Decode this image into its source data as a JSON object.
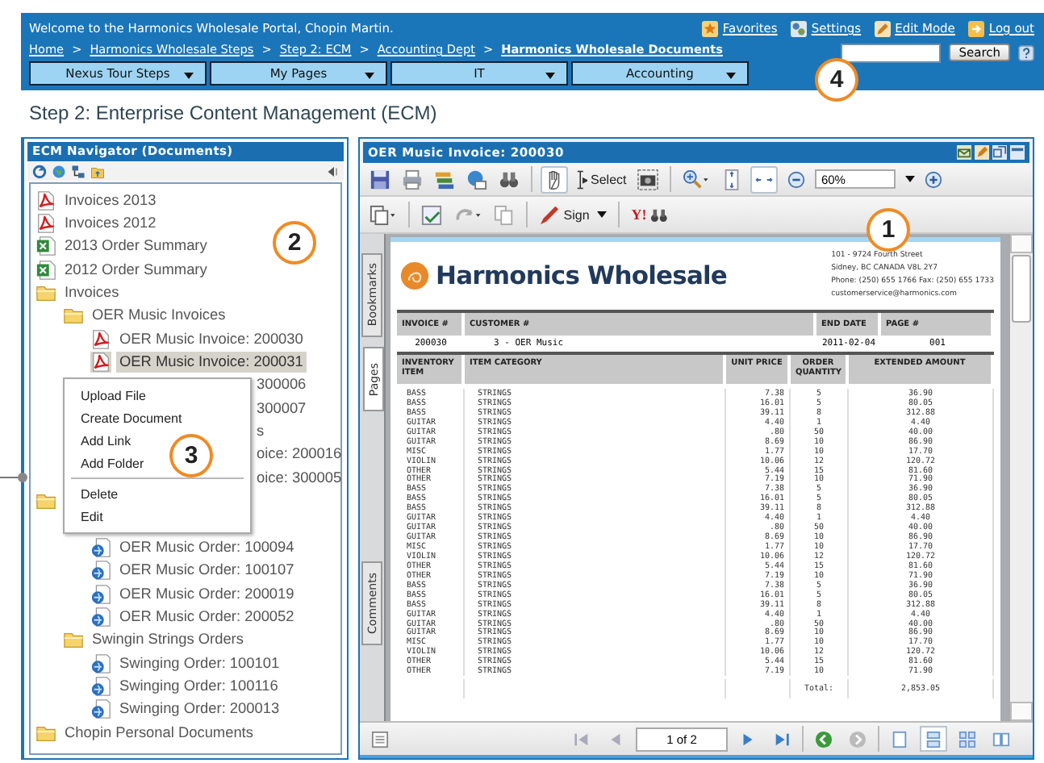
{
  "header": {
    "welcome": "Welcome to the Harmonics Wholesale Portal, Chopin Martin.",
    "links": [
      {
        "kind": "favorites",
        "label": "Favorites"
      },
      {
        "kind": "settings",
        "label": "Settings"
      },
      {
        "kind": "edit",
        "label": "Edit Mode"
      },
      {
        "kind": "logout",
        "label": "Log out"
      }
    ],
    "breadcrumbs": [
      {
        "label": "Home",
        "current": false
      },
      {
        "label": "Harmonics Wholesale Steps",
        "current": false
      },
      {
        "label": "Step 2: ECM",
        "current": false
      },
      {
        "label": "Accounting Dept",
        "current": false
      },
      {
        "label": "Harmonics Wholesale Documents",
        "current": true
      }
    ],
    "breadcrumb_separator": ">",
    "search_button": "Search",
    "menus": [
      {
        "label": "Nexus Tour Steps"
      },
      {
        "label": "My Pages"
      },
      {
        "label": "IT"
      },
      {
        "label": "Accounting"
      }
    ]
  },
  "page_title": "Step 2: Enterprise Content Management (ECM)",
  "navigator": {
    "title": "ECM Navigator (Documents)",
    "tree": [
      {
        "kind": "pdf",
        "label": "Invoices 2013",
        "selected": false
      },
      {
        "kind": "pdf",
        "label": "Invoices 2012",
        "selected": false
      },
      {
        "kind": "sheet",
        "label": "2013 Order Summary",
        "selected": false
      },
      {
        "kind": "sheet",
        "label": "2012 Order Summary",
        "selected": false
      },
      {
        "kind": "folder",
        "label": "Invoices",
        "selected": false,
        "children": [
          {
            "kind": "folder",
            "label": "OER Music Invoices",
            "selected": false,
            "children": [
              {
                "kind": "pdf",
                "label": "OER Music Invoice: 200030",
                "selected": false
              },
              {
                "kind": "pdf",
                "label": "OER Music Invoice: 200031",
                "selected": true
              },
              {
                "kind": "covered",
                "label": "300006",
                "selected": false
              },
              {
                "kind": "covered",
                "label": "300007",
                "selected": false
              }
            ]
          },
          {
            "kind": "covered",
            "label": "s",
            "selected": false,
            "children": [
              {
                "kind": "covered",
                "label": "oice: 200016",
                "selected": false
              },
              {
                "kind": "covered",
                "label": "oice: 300005",
                "selected": false
              }
            ]
          }
        ]
      },
      {
        "kind": "folder",
        "selected": false,
        "children": [
          {
            "kind": "covered",
            "children": [
              {
                "kind": "web",
                "label": "OER Music Order: 100094",
                "selected": false
              },
              {
                "kind": "web",
                "label": "OER Music Order: 100107",
                "selected": false
              },
              {
                "kind": "web",
                "label": "OER Music Order: 200019",
                "selected": false
              },
              {
                "kind": "web",
                "label": "OER Music Order: 200052",
                "selected": false
              }
            ]
          },
          {
            "kind": "folder",
            "label": "Swingin Strings Orders",
            "selected": false,
            "children": [
              {
                "kind": "web",
                "label": "Swinging Order: 100101",
                "selected": false
              },
              {
                "kind": "web",
                "label": "Swinging Order: 100116",
                "selected": false
              },
              {
                "kind": "web",
                "label": "Swinging Order: 200013",
                "selected": false
              }
            ]
          }
        ]
      },
      {
        "kind": "folder",
        "label": "Chopin Personal Documents",
        "selected": false
      }
    ],
    "context_menu": [
      {
        "kind": "item",
        "label": "Upload File"
      },
      {
        "kind": "item",
        "label": "Create Document"
      },
      {
        "kind": "item",
        "label": "Add Link"
      },
      {
        "kind": "item",
        "label": "Add Folder"
      },
      {
        "kind": "separator"
      },
      {
        "kind": "item",
        "label": "Delete"
      },
      {
        "kind": "item",
        "label": "Edit"
      }
    ]
  },
  "viewer": {
    "title": "OER Music Invoice: 200030",
    "select_label": "Select",
    "zoom": "60%",
    "sign_label": "Sign",
    "search_logo": "Y!",
    "side_tabs": [
      {
        "label": "Bookmarks",
        "selected": false
      },
      {
        "label": "Pages",
        "selected": true
      },
      {
        "label": "Comments",
        "selected": false
      }
    ],
    "page_field": "1 of 2",
    "document": {
      "company": "Harmonics Wholesale",
      "address": [
        "101 - 9724 Fourth Street",
        "Sidney, BC CANADA V8L 2Y7",
        "Phone: (250) 655 1766 Fax: (250) 655 1733",
        "customerservice@harmonics.com"
      ],
      "info_columns": [
        "INVOICE #",
        "CUSTOMER #",
        "END DATE",
        "PAGE #"
      ],
      "info_values": [
        "200030",
        "3 - OER Music",
        "2011-02-04",
        "001"
      ],
      "item_columns": [
        "INVENTORY ITEM",
        "ITEM CATEGORY",
        "UNIT PRICE",
        "ORDER QUANTITY",
        "EXTENDED AMOUNT"
      ],
      "rows": [
        [
          "BASS",
          "STRINGS",
          "7.38",
          "5",
          "36.90"
        ],
        [
          "BASS",
          "STRINGS",
          "16.01",
          "5",
          "80.05"
        ],
        [
          "BASS",
          "STRINGS",
          "39.11",
          "8",
          "312.88"
        ],
        [
          "GUITAR",
          "STRINGS",
          "4.40",
          "1",
          "4.40"
        ],
        [
          "GUITAR",
          "STRINGS",
          ".80",
          "50",
          "40.00"
        ],
        [
          "GUITAR",
          "STRINGS",
          "8.69",
          "10",
          "86.90"
        ],
        [
          "MISC",
          "STRINGS",
          "1.77",
          "10",
          "17.70"
        ],
        [
          "VIOLIN",
          "STRINGS",
          "10.06",
          "12",
          "120.72"
        ],
        [
          "OTHER",
          "STRINGS",
          "5.44",
          "15",
          "81.60"
        ],
        [
          "OTHER",
          "STRINGS",
          "7.19",
          "10",
          "71.90"
        ],
        [
          "BASS",
          "STRINGS",
          "7.38",
          "5",
          "36.90"
        ],
        [
          "BASS",
          "STRINGS",
          "16.01",
          "5",
          "80.05"
        ],
        [
          "BASS",
          "STRINGS",
          "39.11",
          "8",
          "312.88"
        ],
        [
          "GUITAR",
          "STRINGS",
          "4.40",
          "1",
          "4.40"
        ],
        [
          "GUITAR",
          "STRINGS",
          ".80",
          "50",
          "40.00"
        ],
        [
          "GUITAR",
          "STRINGS",
          "8.69",
          "10",
          "86.90"
        ],
        [
          "MISC",
          "STRINGS",
          "1.77",
          "10",
          "17.70"
        ],
        [
          "VIOLIN",
          "STRINGS",
          "10.06",
          "12",
          "120.72"
        ],
        [
          "OTHER",
          "STRINGS",
          "5.44",
          "15",
          "81.60"
        ],
        [
          "OTHER",
          "STRINGS",
          "7.19",
          "10",
          "71.90"
        ],
        [
          "BASS",
          "STRINGS",
          "7.38",
          "5",
          "36.90"
        ],
        [
          "BASS",
          "STRINGS",
          "16.01",
          "5",
          "80.05"
        ],
        [
          "BASS",
          "STRINGS",
          "39.11",
          "8",
          "312.88"
        ],
        [
          "GUITAR",
          "STRINGS",
          "4.40",
          "1",
          "4.40"
        ],
        [
          "GUITAR",
          "STRINGS",
          ".80",
          "50",
          "40.00"
        ],
        [
          "GUITAR",
          "STRINGS",
          "8.69",
          "10",
          "86.90"
        ],
        [
          "MISC",
          "STRINGS",
          "1.77",
          "10",
          "17.70"
        ],
        [
          "VIOLIN",
          "STRINGS",
          "10.06",
          "12",
          "120.72"
        ],
        [
          "OTHER",
          "STRINGS",
          "5.44",
          "15",
          "81.60"
        ],
        [
          "OTHER",
          "STRINGS",
          "7.19",
          "10",
          "71.90"
        ]
      ],
      "total_label": "Total:",
      "total": "2,853.05"
    }
  },
  "callouts": [
    {
      "label": "1"
    },
    {
      "label": "2"
    },
    {
      "label": "3"
    },
    {
      "label": "4"
    }
  ]
}
